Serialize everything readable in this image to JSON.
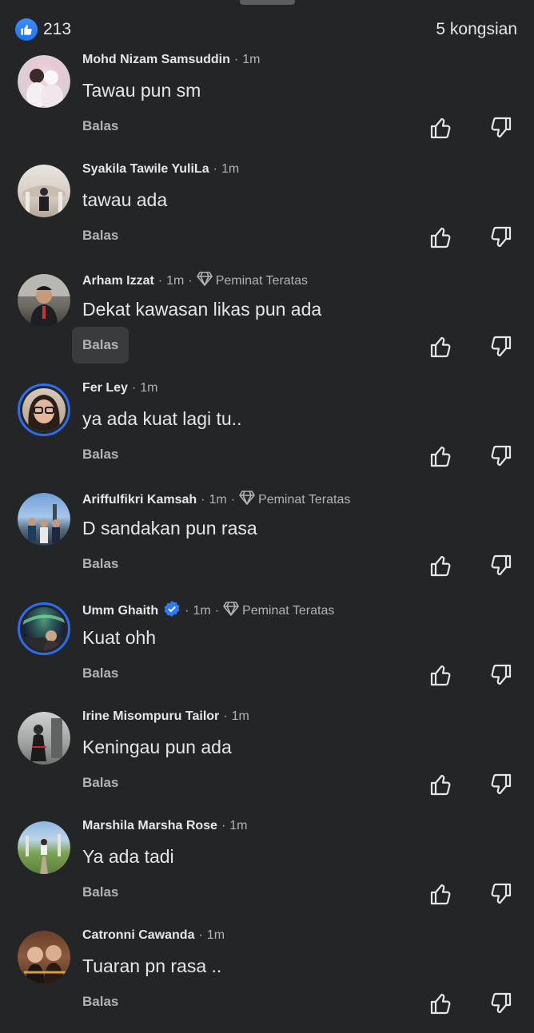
{
  "header": {
    "reaction_count": "213",
    "shares": "5 kongsian"
  },
  "comments": [
    {
      "name": "Mohd Nizam Samsuddin",
      "time": "1m",
      "text": "Tawau pun sm",
      "reply": "Balas",
      "top_fan": false
    },
    {
      "name": "Syakila Tawile YuliLa",
      "time": "1m",
      "text": "tawau ada",
      "reply": "Balas",
      "top_fan": false
    },
    {
      "name": "Arham Izzat",
      "time": "1m",
      "badge": "Peminat Teratas",
      "text": "Dekat kawasan likas pun ada",
      "reply": "Balas",
      "top_fan": true
    },
    {
      "name": "Fer Ley",
      "time": "1m",
      "text": "ya ada kuat lagi tu..",
      "reply": "Balas",
      "top_fan": false
    },
    {
      "name": "Ariffulfikri Kamsah",
      "time": "1m",
      "badge": "Peminat Teratas",
      "text": "D sandakan pun rasa",
      "reply": "Balas",
      "top_fan": true
    },
    {
      "name": "Umm Ghaith",
      "time": "1m",
      "badge": "Peminat Teratas",
      "text": "Kuat ohh",
      "reply": "Balas",
      "top_fan": true,
      "verified": true
    },
    {
      "name": "Irine Misompuru Tailor",
      "time": "1m",
      "text": "Keningau pun ada",
      "reply": "Balas",
      "top_fan": false
    },
    {
      "name": "Marshila Marsha Rose",
      "time": "1m",
      "text": "Ya ada tadi",
      "reply": "Balas",
      "top_fan": false
    },
    {
      "name": "Catronni Cawanda",
      "time": "1m",
      "text": "Tuaran pn rasa ..",
      "reply": "Balas",
      "top_fan": false
    }
  ],
  "icons": {
    "like": "thumbs-up-icon",
    "dislike": "thumbs-down-icon",
    "top_fan": "diamond-icon",
    "verified": "verified-badge-icon"
  },
  "colors": {
    "background": "#242526",
    "accent": "#1877f2",
    "ring": "#2d6bf2",
    "secondary_text": "#b0b3b8"
  }
}
